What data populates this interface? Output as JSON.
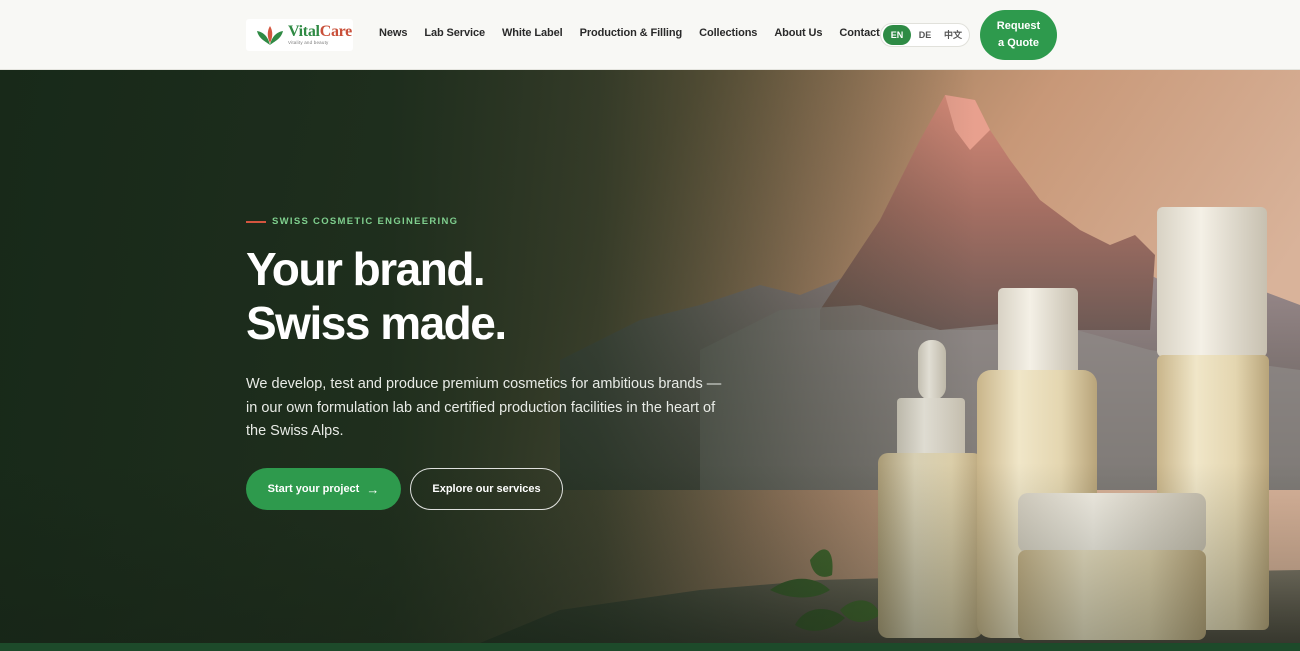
{
  "brand": {
    "name_part1": "Vital",
    "name_part2": "Care",
    "tagline": "Vitality and beauty"
  },
  "nav": {
    "items": [
      {
        "label": "News"
      },
      {
        "label": "Lab Service"
      },
      {
        "label": "White Label"
      },
      {
        "label": "Production & Filling"
      },
      {
        "label": "Collections"
      },
      {
        "label": "About Us"
      },
      {
        "label": "Contact"
      }
    ]
  },
  "language": {
    "options": [
      "EN",
      "DE",
      "中文"
    ],
    "selected": "EN"
  },
  "header": {
    "cta_line1": "Request",
    "cta_line2": "a Quote"
  },
  "hero": {
    "eyebrow": "SWISS COSMETIC ENGINEERING",
    "headline_line1": "Your brand.",
    "headline_line2": "Swiss made.",
    "subtext": "We develop, test and produce premium cosmetics for ambitious brands — in our own formulation lab and certified production facilities in the heart of the Swiss Alps.",
    "primary_cta": "Start your project",
    "primary_cta_icon": "arrow-right-icon",
    "secondary_cta": "Explore our services"
  },
  "colors": {
    "brand_green": "#2e9a4d",
    "accent_red": "#d4553f",
    "eyebrow_green": "#7fcf8e",
    "dark_green": "#1d4a2a"
  }
}
